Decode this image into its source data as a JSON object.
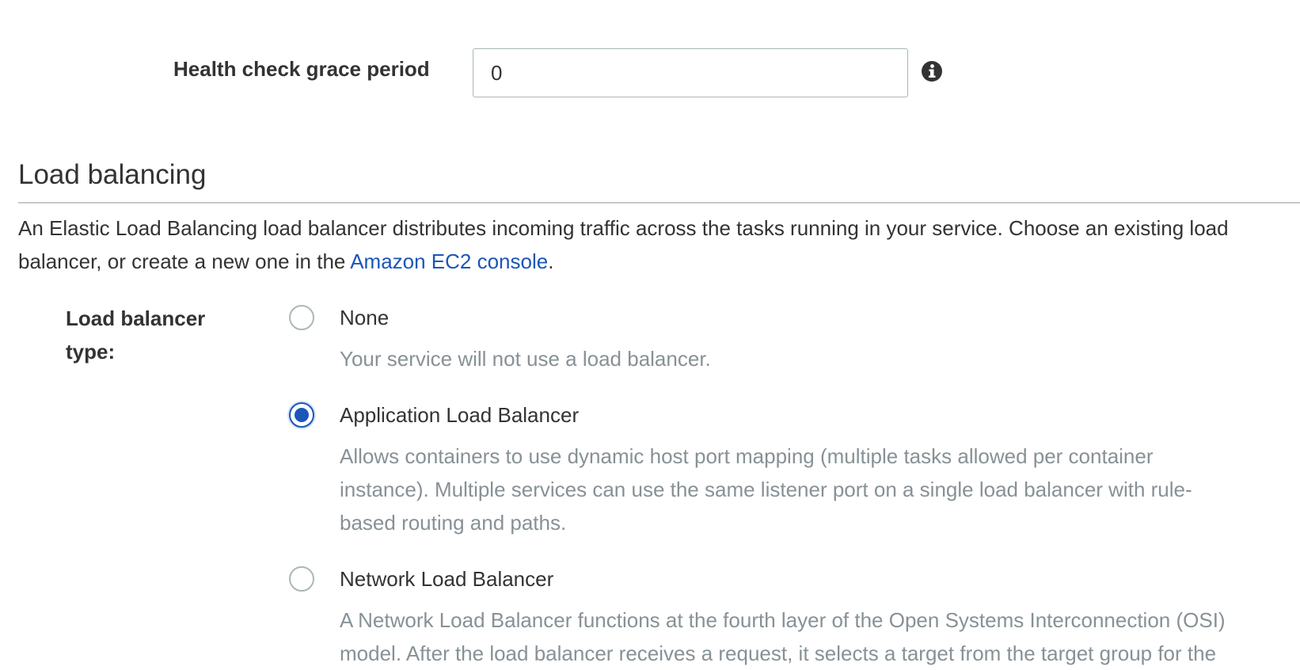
{
  "health_check": {
    "label": "Health check grace period",
    "value": "0",
    "info_icon": "info-icon"
  },
  "load_balancing": {
    "title": "Load balancing",
    "description_line1": "An Elastic Load Balancing load balancer distributes incoming traffic across the tasks running in your service. Choose an existing load",
    "description_line2_prefix": "balancer, or create a new one in the ",
    "description_link": "Amazon EC2 console",
    "description_line2_suffix": "."
  },
  "lb_type": {
    "label": "Load balancer type:",
    "selected": "Application Load Balancer",
    "options": [
      {
        "label": "None",
        "description_lines": [
          "Your service will not use a load balancer."
        ]
      },
      {
        "label": "Application Load Balancer",
        "description_lines": [
          "Allows containers to use dynamic host port mapping (multiple tasks allowed per container",
          "instance). Multiple services can use the same listener port on a single load balancer with rule-",
          "based routing and paths."
        ]
      },
      {
        "label": "Network Load Balancer",
        "description_lines": [
          "A Network Load Balancer functions at the fourth layer of the Open Systems Interconnection (OSI)",
          "model. After the load balancer receives a request, it selects a target from the target group for the"
        ]
      }
    ]
  },
  "colors": {
    "link": "#1a56b8",
    "radio_selected": "#1a56b8",
    "muted_text": "#879196",
    "body_text": "#333333",
    "rule": "#c8c8c8"
  }
}
